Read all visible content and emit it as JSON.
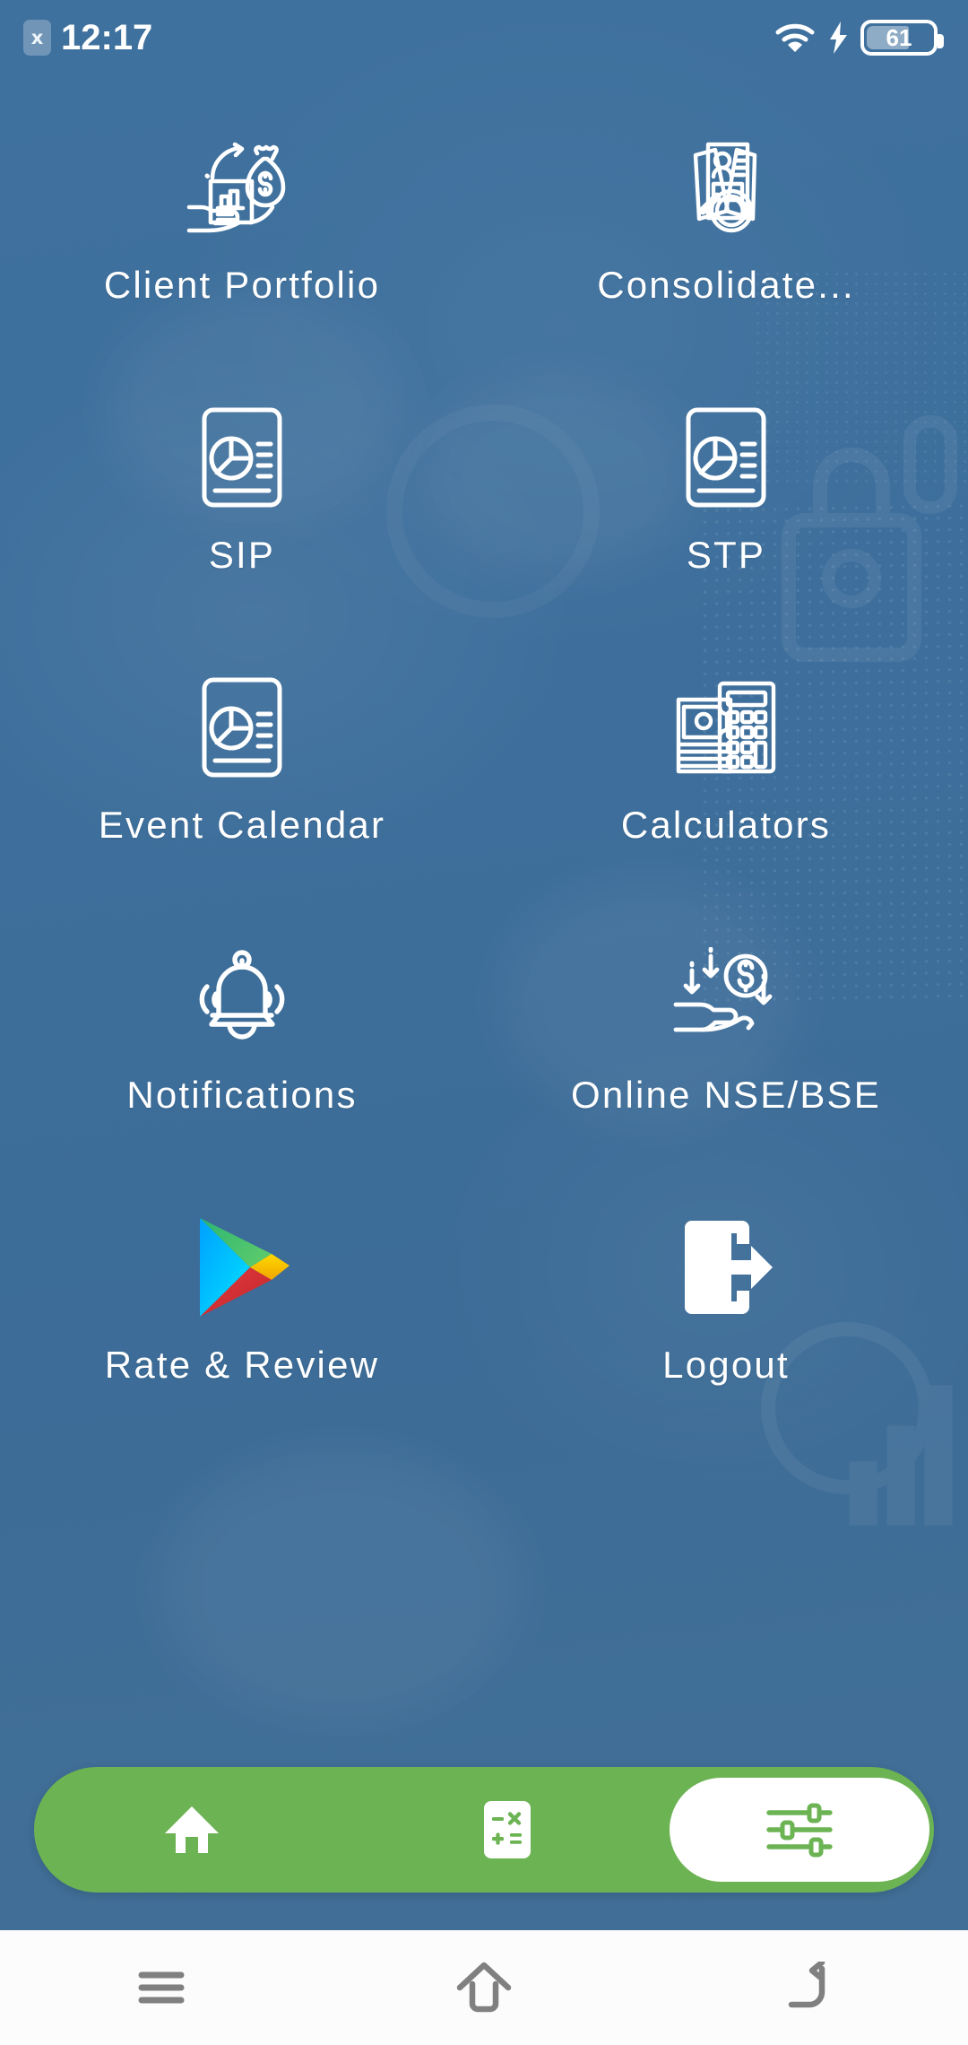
{
  "status_bar": {
    "app_badge_icon": "x-badge-icon",
    "app_badge_label": "x",
    "time": "12:17",
    "wifi_icon": "wifi-icon",
    "charging_icon": "charging-bolt-icon",
    "battery_icon": "battery-icon",
    "battery_percent": "61"
  },
  "theme": {
    "background": "#3d6d99",
    "accent_green": "#6cb353",
    "icon_white": "#ffffff",
    "sysnav_background": "#fcfcfc",
    "sysnav_icon": "#808080"
  },
  "menu": {
    "items": [
      {
        "label": "Client Portfolio",
        "icon": "portfolio-hand-money-icon"
      },
      {
        "label": "Consolidate...",
        "icon": "consolidated-documents-search-icon"
      },
      {
        "label": "SIP",
        "icon": "report-pie-chart-icon"
      },
      {
        "label": "STP",
        "icon": "report-pie-chart-icon"
      },
      {
        "label": "Event Calendar",
        "icon": "report-pie-chart-icon"
      },
      {
        "label": "Calculators",
        "icon": "calculator-money-icon"
      },
      {
        "label": "Notifications",
        "icon": "bell-ringing-icon"
      },
      {
        "label": "Online NSE/BSE",
        "icon": "hand-receiving-money-icon"
      },
      {
        "label": "Rate & Review",
        "icon": "google-play-icon"
      },
      {
        "label": "Logout",
        "icon": "logout-door-arrow-icon"
      }
    ]
  },
  "bottom_nav": {
    "items": [
      {
        "name": "home",
        "icon": "home-icon",
        "active": false
      },
      {
        "name": "calculator",
        "icon": "calculator-icon",
        "active": false
      },
      {
        "name": "settings",
        "icon": "sliders-icon",
        "active": true
      }
    ]
  },
  "system_nav": {
    "items": [
      {
        "name": "recents",
        "icon": "menu-lines-icon"
      },
      {
        "name": "home",
        "icon": "home-outline-icon"
      },
      {
        "name": "back",
        "icon": "back-arrow-icon"
      }
    ]
  }
}
